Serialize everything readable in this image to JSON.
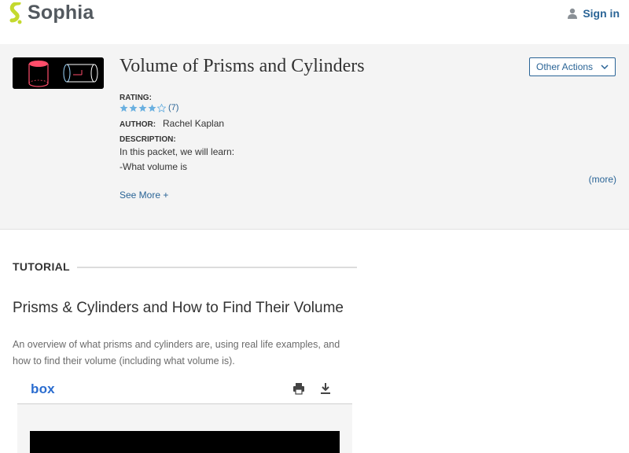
{
  "header": {
    "logo_text": "Sophia",
    "signin_label": "Sign in"
  },
  "packet": {
    "title": "Volume of Prisms and Cylinders",
    "other_actions_label": "Other Actions",
    "rating_label": "RATING:",
    "rating_stars": 4,
    "rating_max": 5,
    "rating_count": "(7)",
    "author_label": "AUTHOR:",
    "author_name": "Rachel Kaplan",
    "description_label": "DESCRIPTION:",
    "description_lines": [
      "In this packet, we will learn:",
      "-What volume is"
    ],
    "more_label": "(more)",
    "see_more_label": "See More +"
  },
  "tutorial": {
    "section_label": "TUTORIAL",
    "title": "Prisms & Cylinders and How to Find Their Volume",
    "description": "An overview of what prisms and cylinders are, using real life examples, and how to find their volume (including what volume is)."
  },
  "box": {
    "logo_text": "box"
  },
  "colors": {
    "link": "#2a6496",
    "logo_green": "#c4d92e",
    "hero_bg": "#f4f4f4",
    "star": "#6ab0e0"
  }
}
